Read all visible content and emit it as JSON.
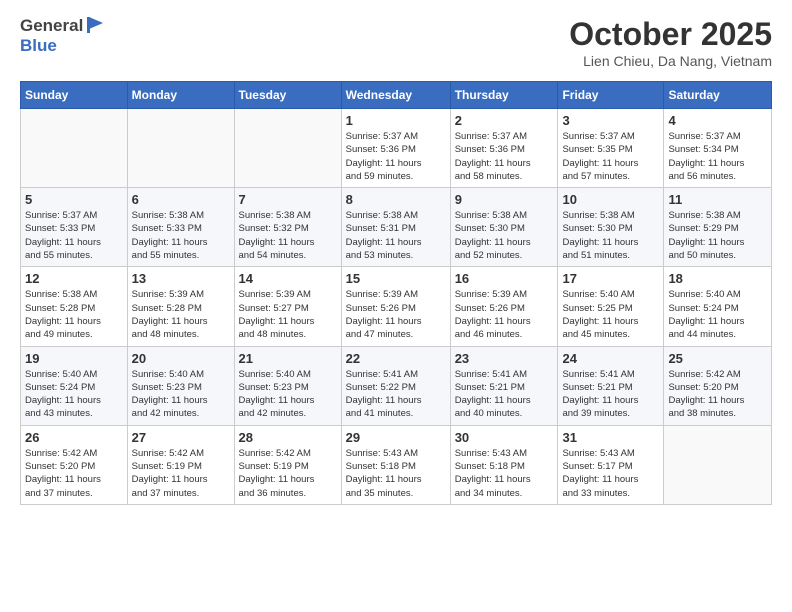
{
  "header": {
    "logo_general": "General",
    "logo_blue": "Blue",
    "month_title": "October 2025",
    "location": "Lien Chieu, Da Nang, Vietnam"
  },
  "weekdays": [
    "Sunday",
    "Monday",
    "Tuesday",
    "Wednesday",
    "Thursday",
    "Friday",
    "Saturday"
  ],
  "weeks": [
    [
      {
        "day": "",
        "info": ""
      },
      {
        "day": "",
        "info": ""
      },
      {
        "day": "",
        "info": ""
      },
      {
        "day": "1",
        "info": "Sunrise: 5:37 AM\nSunset: 5:36 PM\nDaylight: 11 hours\nand 59 minutes."
      },
      {
        "day": "2",
        "info": "Sunrise: 5:37 AM\nSunset: 5:36 PM\nDaylight: 11 hours\nand 58 minutes."
      },
      {
        "day": "3",
        "info": "Sunrise: 5:37 AM\nSunset: 5:35 PM\nDaylight: 11 hours\nand 57 minutes."
      },
      {
        "day": "4",
        "info": "Sunrise: 5:37 AM\nSunset: 5:34 PM\nDaylight: 11 hours\nand 56 minutes."
      }
    ],
    [
      {
        "day": "5",
        "info": "Sunrise: 5:37 AM\nSunset: 5:33 PM\nDaylight: 11 hours\nand 55 minutes."
      },
      {
        "day": "6",
        "info": "Sunrise: 5:38 AM\nSunset: 5:33 PM\nDaylight: 11 hours\nand 55 minutes."
      },
      {
        "day": "7",
        "info": "Sunrise: 5:38 AM\nSunset: 5:32 PM\nDaylight: 11 hours\nand 54 minutes."
      },
      {
        "day": "8",
        "info": "Sunrise: 5:38 AM\nSunset: 5:31 PM\nDaylight: 11 hours\nand 53 minutes."
      },
      {
        "day": "9",
        "info": "Sunrise: 5:38 AM\nSunset: 5:30 PM\nDaylight: 11 hours\nand 52 minutes."
      },
      {
        "day": "10",
        "info": "Sunrise: 5:38 AM\nSunset: 5:30 PM\nDaylight: 11 hours\nand 51 minutes."
      },
      {
        "day": "11",
        "info": "Sunrise: 5:38 AM\nSunset: 5:29 PM\nDaylight: 11 hours\nand 50 minutes."
      }
    ],
    [
      {
        "day": "12",
        "info": "Sunrise: 5:38 AM\nSunset: 5:28 PM\nDaylight: 11 hours\nand 49 minutes."
      },
      {
        "day": "13",
        "info": "Sunrise: 5:39 AM\nSunset: 5:28 PM\nDaylight: 11 hours\nand 48 minutes."
      },
      {
        "day": "14",
        "info": "Sunrise: 5:39 AM\nSunset: 5:27 PM\nDaylight: 11 hours\nand 48 minutes."
      },
      {
        "day": "15",
        "info": "Sunrise: 5:39 AM\nSunset: 5:26 PM\nDaylight: 11 hours\nand 47 minutes."
      },
      {
        "day": "16",
        "info": "Sunrise: 5:39 AM\nSunset: 5:26 PM\nDaylight: 11 hours\nand 46 minutes."
      },
      {
        "day": "17",
        "info": "Sunrise: 5:40 AM\nSunset: 5:25 PM\nDaylight: 11 hours\nand 45 minutes."
      },
      {
        "day": "18",
        "info": "Sunrise: 5:40 AM\nSunset: 5:24 PM\nDaylight: 11 hours\nand 44 minutes."
      }
    ],
    [
      {
        "day": "19",
        "info": "Sunrise: 5:40 AM\nSunset: 5:24 PM\nDaylight: 11 hours\nand 43 minutes."
      },
      {
        "day": "20",
        "info": "Sunrise: 5:40 AM\nSunset: 5:23 PM\nDaylight: 11 hours\nand 42 minutes."
      },
      {
        "day": "21",
        "info": "Sunrise: 5:40 AM\nSunset: 5:23 PM\nDaylight: 11 hours\nand 42 minutes."
      },
      {
        "day": "22",
        "info": "Sunrise: 5:41 AM\nSunset: 5:22 PM\nDaylight: 11 hours\nand 41 minutes."
      },
      {
        "day": "23",
        "info": "Sunrise: 5:41 AM\nSunset: 5:21 PM\nDaylight: 11 hours\nand 40 minutes."
      },
      {
        "day": "24",
        "info": "Sunrise: 5:41 AM\nSunset: 5:21 PM\nDaylight: 11 hours\nand 39 minutes."
      },
      {
        "day": "25",
        "info": "Sunrise: 5:42 AM\nSunset: 5:20 PM\nDaylight: 11 hours\nand 38 minutes."
      }
    ],
    [
      {
        "day": "26",
        "info": "Sunrise: 5:42 AM\nSunset: 5:20 PM\nDaylight: 11 hours\nand 37 minutes."
      },
      {
        "day": "27",
        "info": "Sunrise: 5:42 AM\nSunset: 5:19 PM\nDaylight: 11 hours\nand 37 minutes."
      },
      {
        "day": "28",
        "info": "Sunrise: 5:42 AM\nSunset: 5:19 PM\nDaylight: 11 hours\nand 36 minutes."
      },
      {
        "day": "29",
        "info": "Sunrise: 5:43 AM\nSunset: 5:18 PM\nDaylight: 11 hours\nand 35 minutes."
      },
      {
        "day": "30",
        "info": "Sunrise: 5:43 AM\nSunset: 5:18 PM\nDaylight: 11 hours\nand 34 minutes."
      },
      {
        "day": "31",
        "info": "Sunrise: 5:43 AM\nSunset: 5:17 PM\nDaylight: 11 hours\nand 33 minutes."
      },
      {
        "day": "",
        "info": ""
      }
    ]
  ]
}
